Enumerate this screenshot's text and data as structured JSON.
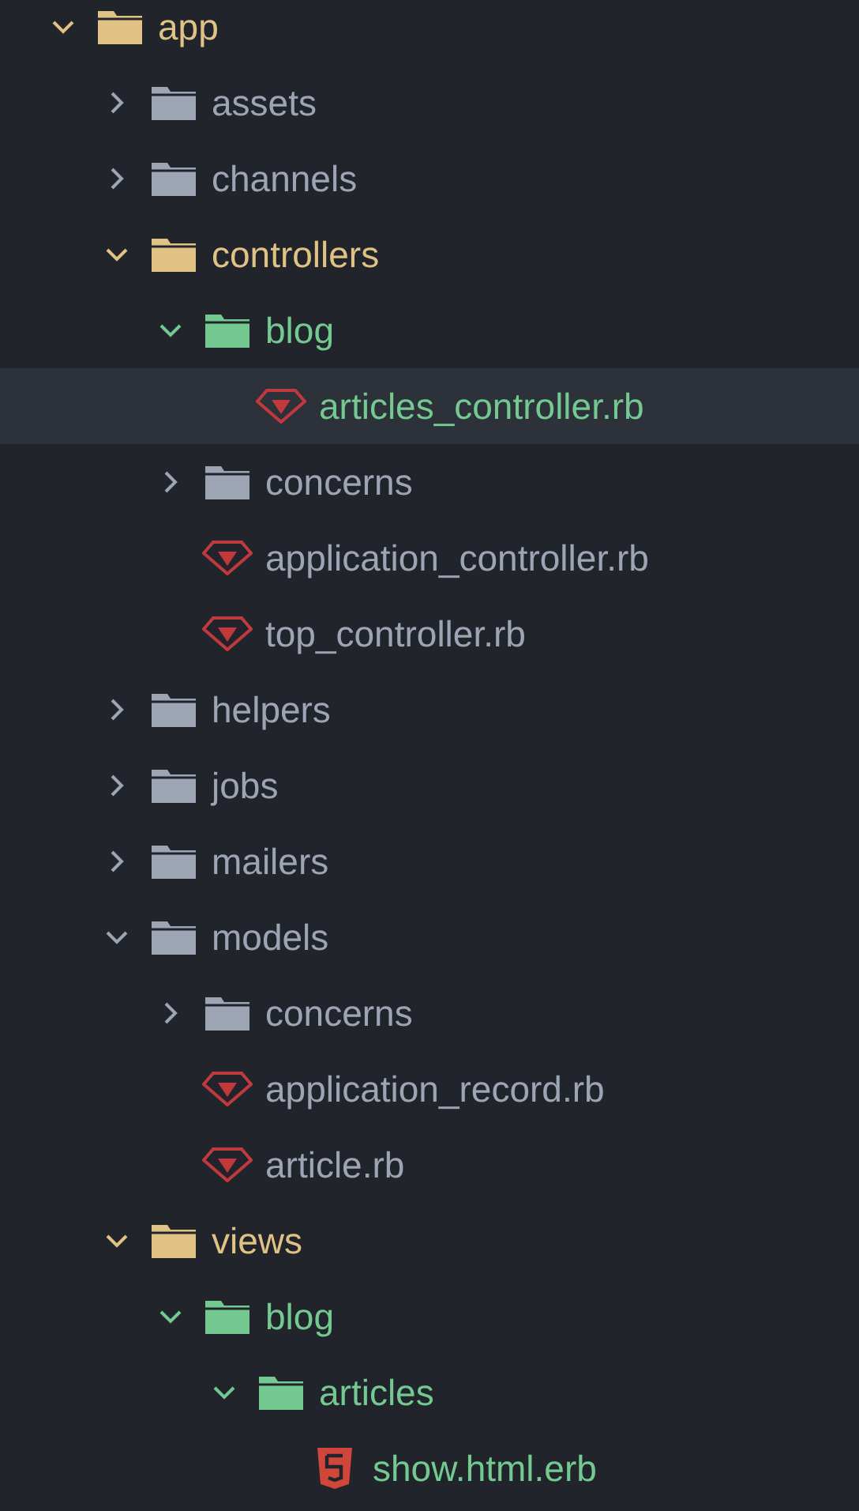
{
  "tree": [
    {
      "kind": "folder",
      "name": "app",
      "color": "#e0c285",
      "expanded": true,
      "selected": false,
      "children": [
        {
          "kind": "folder",
          "name": "assets",
          "color": "#9da5b4",
          "expanded": false,
          "selected": false
        },
        {
          "kind": "folder",
          "name": "channels",
          "color": "#9da5b4",
          "expanded": false,
          "selected": false
        },
        {
          "kind": "folder",
          "name": "controllers",
          "color": "#e0c285",
          "expanded": true,
          "selected": false,
          "children": [
            {
              "kind": "folder",
              "name": "blog",
              "color": "#73c990",
              "expanded": true,
              "selected": false,
              "children": [
                {
                  "kind": "ruby",
                  "name": "articles_controller.rb",
                  "color": "#73c990",
                  "selected": true
                }
              ]
            },
            {
              "kind": "folder",
              "name": "concerns",
              "color": "#9da5b4",
              "expanded": false,
              "selected": false
            },
            {
              "kind": "ruby",
              "name": "application_controller.rb",
              "color": "#9da5b4",
              "selected": false
            },
            {
              "kind": "ruby",
              "name": "top_controller.rb",
              "color": "#9da5b4",
              "selected": false
            }
          ]
        },
        {
          "kind": "folder",
          "name": "helpers",
          "color": "#9da5b4",
          "expanded": false,
          "selected": false
        },
        {
          "kind": "folder",
          "name": "jobs",
          "color": "#9da5b4",
          "expanded": false,
          "selected": false
        },
        {
          "kind": "folder",
          "name": "mailers",
          "color": "#9da5b4",
          "expanded": false,
          "selected": false
        },
        {
          "kind": "folder",
          "name": "models",
          "color": "#9da5b4",
          "expanded": true,
          "selected": false,
          "children": [
            {
              "kind": "folder",
              "name": "concerns",
              "color": "#9da5b4",
              "expanded": false,
              "selected": false
            },
            {
              "kind": "ruby",
              "name": "application_record.rb",
              "color": "#9da5b4",
              "selected": false
            },
            {
              "kind": "ruby",
              "name": "article.rb",
              "color": "#9da5b4",
              "selected": false
            }
          ]
        },
        {
          "kind": "folder",
          "name": "views",
          "color": "#e0c285",
          "expanded": true,
          "selected": false,
          "children": [
            {
              "kind": "folder",
              "name": "blog",
              "color": "#73c990",
              "expanded": true,
              "selected": false,
              "children": [
                {
                  "kind": "folder",
                  "name": "articles",
                  "color": "#73c990",
                  "expanded": true,
                  "selected": false,
                  "children": [
                    {
                      "kind": "html",
                      "name": "show.html.erb",
                      "color": "#73c990",
                      "selected": false
                    }
                  ]
                }
              ]
            }
          ]
        }
      ]
    }
  ]
}
